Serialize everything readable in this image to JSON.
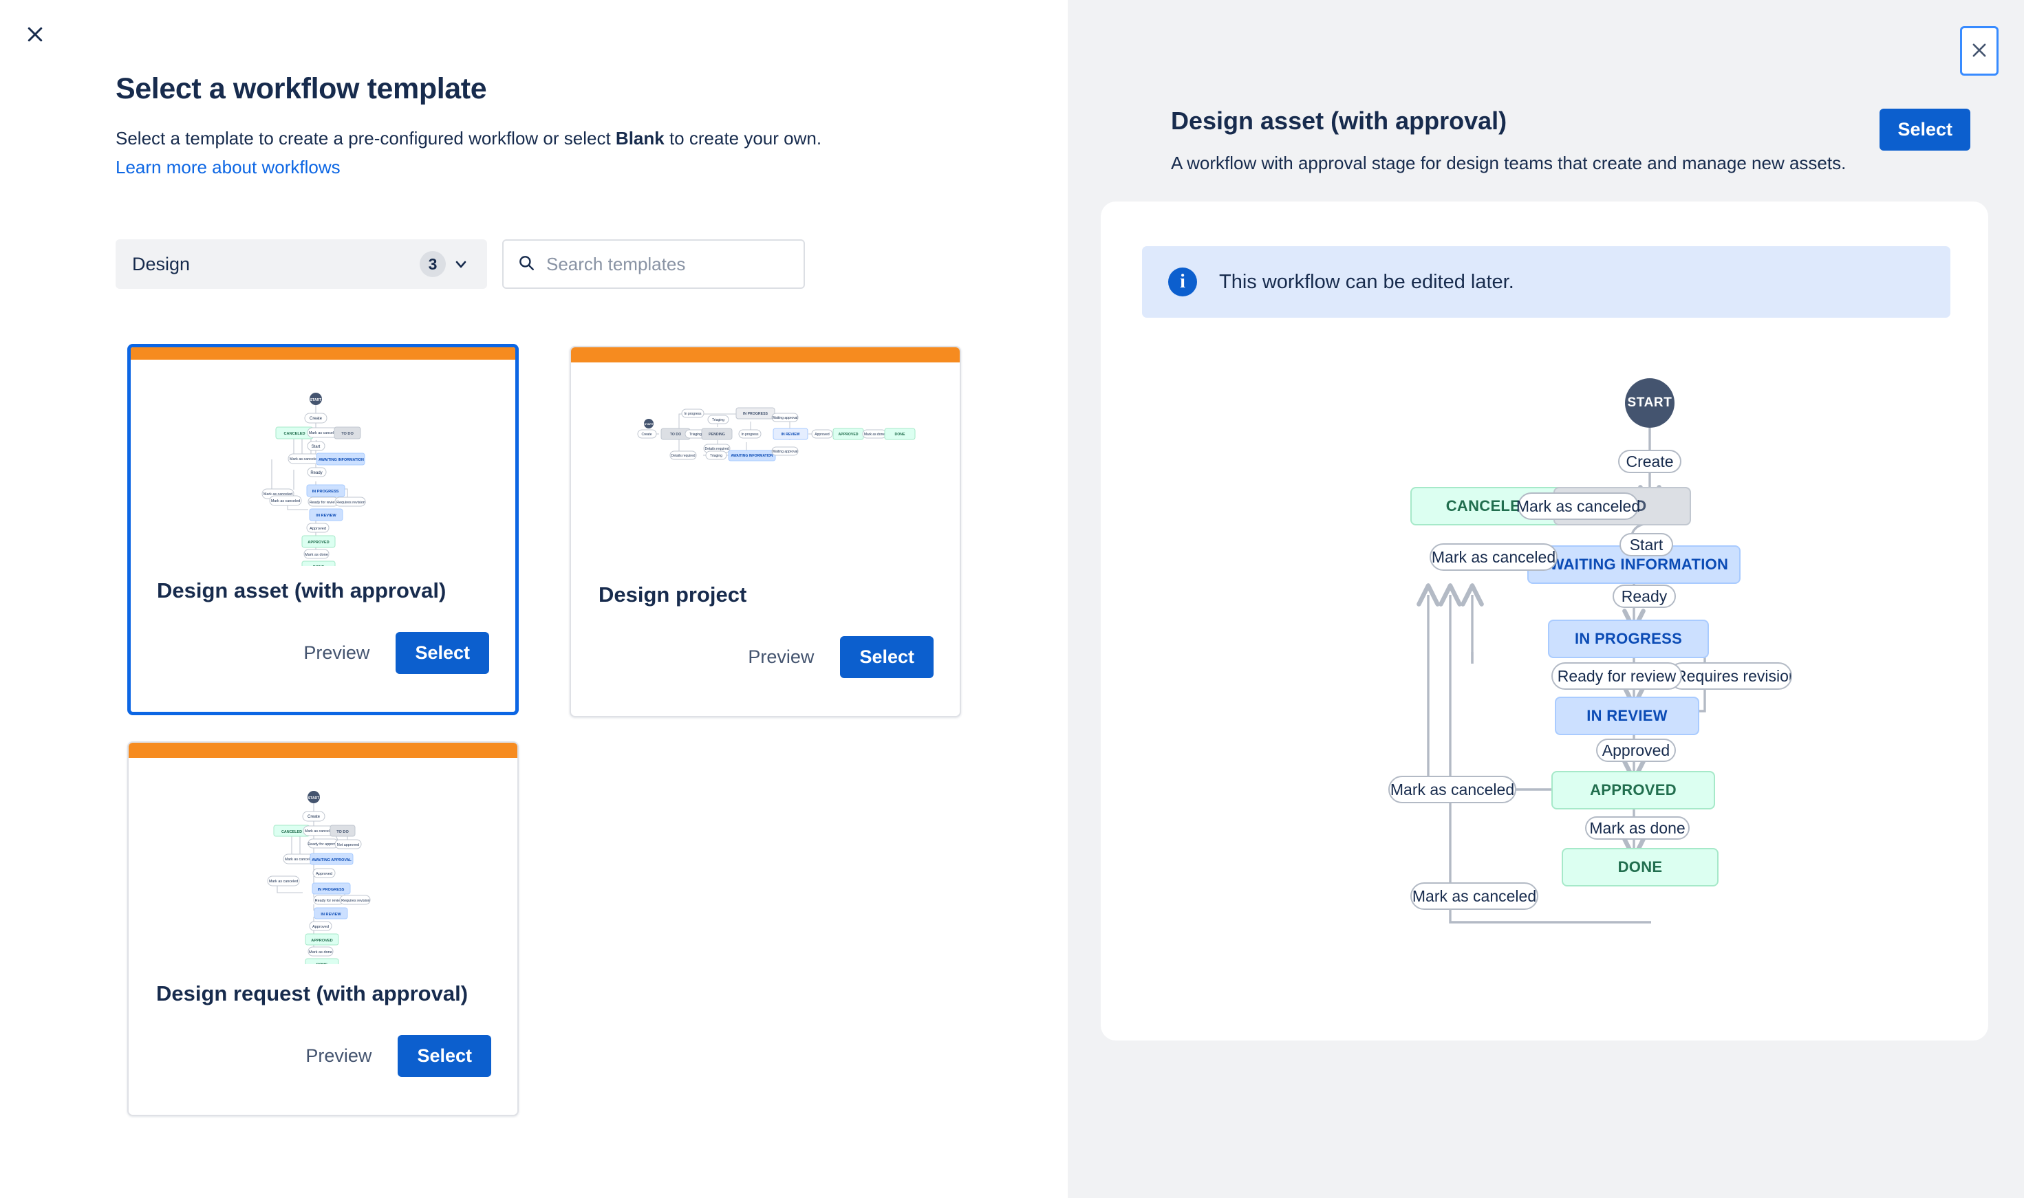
{
  "modal": {
    "close_icon": "close-icon",
    "title": "Select a workflow template",
    "subtitle_before": "Select a template to create a pre-configured workflow or select ",
    "subtitle_bold": "Blank",
    "subtitle_after": " to create your own.",
    "learn_more_link": "Learn more about workflows"
  },
  "filters": {
    "category": {
      "label": "Design",
      "count": "3",
      "chevron_icon": "chevron-down-icon"
    },
    "search": {
      "placeholder": "Search templates",
      "value": "",
      "icon": "search-icon"
    }
  },
  "templates": [
    {
      "name": "Design asset (with approval)",
      "preview_label": "Preview",
      "select_label": "Select",
      "selected": true,
      "stripe_color": "#F68B1F"
    },
    {
      "name": "Design project",
      "preview_label": "Preview",
      "select_label": "Select",
      "selected": false,
      "stripe_color": "#F68B1F"
    },
    {
      "name": "Design request (with approval)",
      "preview_label": "Preview",
      "select_label": "Select",
      "selected": false,
      "stripe_color": "#F68B1F"
    }
  ],
  "preview_panel": {
    "close_icon": "close-icon",
    "title": "Design asset (with approval)",
    "select_label": "Select",
    "description": "A workflow with approval stage for design teams that create and manage new assets.",
    "info_banner": {
      "icon": "info-icon",
      "text": "This workflow can be edited later."
    }
  },
  "workflow": {
    "start_label": "START",
    "statuses": [
      {
        "id": "todo",
        "label": "TO DO",
        "category": "todo"
      },
      {
        "id": "canceled",
        "label": "CANCELED",
        "category": "done"
      },
      {
        "id": "awaiting",
        "label": "AWAITING INFORMATION",
        "category": "inprogress"
      },
      {
        "id": "inprog",
        "label": "IN PROGRESS",
        "category": "inprogress"
      },
      {
        "id": "inreview",
        "label": "IN REVIEW",
        "category": "inprogress"
      },
      {
        "id": "approved",
        "label": "APPROVED",
        "category": "done"
      },
      {
        "id": "done",
        "label": "DONE",
        "category": "done"
      }
    ],
    "transitions": [
      {
        "id": "t_create",
        "label": "Create"
      },
      {
        "id": "t_cancel1",
        "label": "Mark as canceled"
      },
      {
        "id": "t_start",
        "label": "Start"
      },
      {
        "id": "t_cancel2",
        "label": "Mark as canceled"
      },
      {
        "id": "t_ready",
        "label": "Ready"
      },
      {
        "id": "t_cancel3",
        "label": "Mark as canceled"
      },
      {
        "id": "t_cancel4",
        "label": "Mark as canceled"
      },
      {
        "id": "t_r4r",
        "label": "Ready for review"
      },
      {
        "id": "t_revise",
        "label": "Requires revision"
      },
      {
        "id": "t_approve",
        "label": "Approved"
      },
      {
        "id": "t_done",
        "label": "Mark as done"
      }
    ]
  },
  "colors": {
    "brand_blue": "#0C5FCE",
    "link_blue": "#0C66E4",
    "stripe_orange": "#F68B1F",
    "text_dark": "#172B4D",
    "panel_bg": "#F1F2F4",
    "status_todo": "#DCDFE4",
    "status_green": "#DCFFF1",
    "status_blue": "#CCE0FF",
    "start_node": "#44546F"
  }
}
